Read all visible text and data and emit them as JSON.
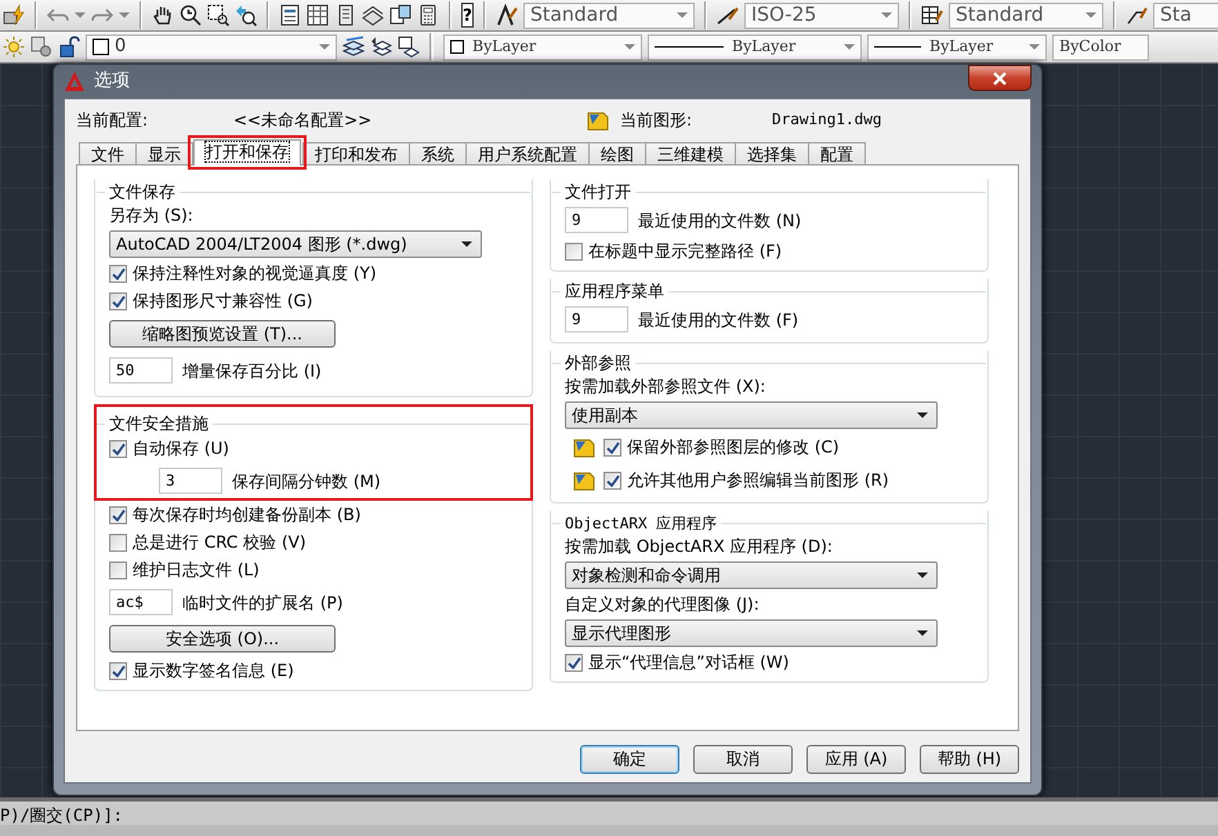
{
  "toolbar": {
    "help_glyph": "?",
    "dropdowns": [
      {
        "value": "Standard"
      },
      {
        "value": "ISO-25"
      },
      {
        "value": "Standard"
      },
      {
        "value": "Sta"
      }
    ]
  },
  "properties_bar": {
    "layer": "0",
    "color_setting": "ByLayer",
    "linetype": "ByLayer",
    "lineweight": "ByLayer",
    "plot_style": "ByColor"
  },
  "dialog": {
    "title": "选项",
    "current_profile_label": "当前配置:",
    "current_profile": "<<未命名配置>>",
    "current_drawing_label": "当前图形:",
    "current_drawing": "Drawing1.dwg",
    "tabs": [
      {
        "label": "文件",
        "selected": false,
        "highlighted": false
      },
      {
        "label": "显示",
        "selected": false,
        "highlighted": false
      },
      {
        "label": "打开和保存",
        "selected": true,
        "highlighted": true
      },
      {
        "label": "打印和发布",
        "selected": false,
        "highlighted": false
      },
      {
        "label": "系统",
        "selected": false,
        "highlighted": false
      },
      {
        "label": "用户系统配置",
        "selected": false,
        "highlighted": false
      },
      {
        "label": "绘图",
        "selected": false,
        "highlighted": false
      },
      {
        "label": "三维建模",
        "selected": false,
        "highlighted": false
      },
      {
        "label": "选择集",
        "selected": false,
        "highlighted": false
      },
      {
        "label": "配置",
        "selected": false,
        "highlighted": false
      }
    ],
    "left_groups": [
      {
        "title": "文件保存",
        "highlighted": false,
        "items": [
          {
            "kind": "label",
            "text": "另存为 (S):"
          },
          {
            "kind": "dropdown",
            "value": "AutoCAD 2004/LT2004 图形 (*.dwg)"
          },
          {
            "kind": "checkbox",
            "label": "保持注释性对象的视觉逼真度 (Y)",
            "checked": true
          },
          {
            "kind": "checkbox",
            "label": "保持图形尺寸兼容性 (G)",
            "checked": true
          },
          {
            "kind": "button",
            "label": "缩略图预览设置 (T)..."
          },
          {
            "kind": "field",
            "value": "50",
            "caption": "增量保存百分比 (I)"
          }
        ]
      },
      {
        "title": "文件安全措施",
        "highlighted": true,
        "items": [
          {
            "kind": "checkbox",
            "label": "自动保存 (U)",
            "checked": true,
            "highlighted": true
          },
          {
            "kind": "subfield",
            "value": "3",
            "caption": "保存间隔分钟数 (M)",
            "highlighted": true
          },
          {
            "kind": "checkbox",
            "label": "每次保存时均创建备份副本 (B)",
            "checked": true,
            "highlighted": false
          },
          {
            "kind": "checkbox",
            "label": "总是进行 CRC 校验 (V)",
            "checked": false,
            "highlighted": false
          },
          {
            "kind": "checkbox",
            "label": "维护日志文件 (L)",
            "checked": false,
            "highlighted": false
          },
          {
            "kind": "field",
            "value": "ac$",
            "caption": "临时文件的扩展名 (P)",
            "highlighted": false
          },
          {
            "kind": "button",
            "label": "安全选项 (O)...",
            "highlighted": false
          },
          {
            "kind": "checkbox",
            "label": "显示数字签名信息 (E)",
            "checked": true,
            "highlighted": false
          }
        ]
      }
    ],
    "right_groups": [
      {
        "title": "文件打开",
        "items": [
          {
            "kind": "field",
            "value": "9",
            "caption": "最近使用的文件数 (N)"
          },
          {
            "kind": "checkbox",
            "label": "在标题中显示完整路径 (F)",
            "checked": false
          }
        ]
      },
      {
        "title": "应用程序菜单",
        "items": [
          {
            "kind": "field",
            "value": "9",
            "caption": "最近使用的文件数 (F)"
          }
        ]
      },
      {
        "title": "外部参照",
        "items": [
          {
            "kind": "label",
            "text": "按需加载外部参照文件 (X):"
          },
          {
            "kind": "dropdown",
            "value": "使用副本"
          },
          {
            "kind": "drawing_checkbox",
            "label": "保留外部参照图层的修改 (C)",
            "checked": true
          },
          {
            "kind": "drawing_checkbox",
            "label": "允许其他用户参照编辑当前图形 (R)",
            "checked": true
          }
        ]
      },
      {
        "title": "ObjectARX 应用程序",
        "items": [
          {
            "kind": "label",
            "text": "按需加载 ObjectARX 应用程序 (D):"
          },
          {
            "kind": "dropdown",
            "value": "对象检测和命令调用"
          },
          {
            "kind": "label",
            "text": "自定义对象的代理图像 (J):"
          },
          {
            "kind": "dropdown",
            "value": "显示代理图形"
          },
          {
            "kind": "checkbox",
            "label": "显示“代理信息”对话框 (W)",
            "checked": true
          }
        ]
      }
    ],
    "buttons": [
      {
        "label": "确定",
        "default": true
      },
      {
        "label": "取消",
        "default": false
      },
      {
        "label": "应用 (A)",
        "default": false
      },
      {
        "label": "帮助 (H)",
        "default": false
      }
    ]
  },
  "command_line": "P)/圈交(CP)]:"
}
